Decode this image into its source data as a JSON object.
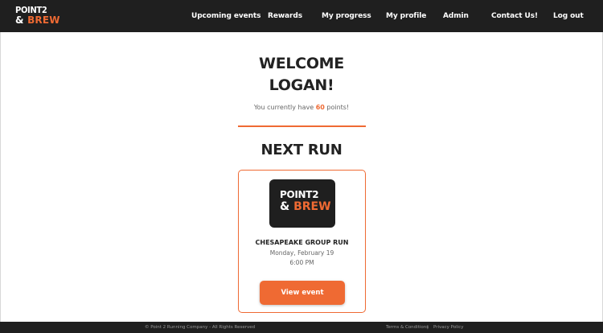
{
  "header": {
    "logo": {
      "line1": "POINT2",
      "amp": "&",
      "brew": "BREW"
    },
    "nav": {
      "upcoming": "Upcoming events",
      "rewards": "Rewards",
      "progress": "My progress",
      "profile": "My profile",
      "admin": "Admin",
      "contact": "Contact Us!",
      "logout": "Log out"
    }
  },
  "main": {
    "welcome_line1": "WELCOME",
    "welcome_line2": "LOGAN!",
    "points_prefix": "You currently have",
    "points_value": "60",
    "points_suffix": "points!",
    "next_run_heading": "NEXT RUN",
    "event": {
      "logo_line1": "POINT2",
      "logo_amp": "&",
      "logo_brew": "BREW",
      "title": "CHESAPEAKE GROUP RUN",
      "date": "Monday, February 19",
      "time": "6:00 PM",
      "button": "View event"
    }
  },
  "footer": {
    "copyright": "© Point 2 Running Company - All Rights Reserved",
    "terms": "Terms & Conditions",
    "separator": "|",
    "privacy": "Privacy Policy"
  },
  "colors": {
    "accent": "#ef6a33",
    "header_bg": "#1f1f1f",
    "text": "#222222"
  }
}
